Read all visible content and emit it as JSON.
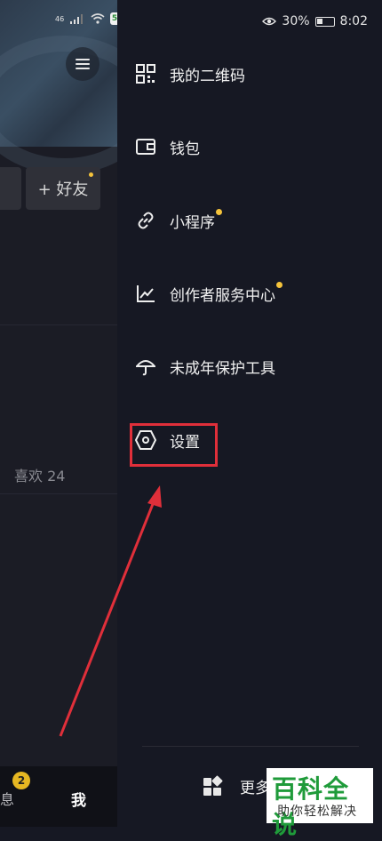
{
  "status_bar": {
    "signal_text": "46",
    "app_badge": "58",
    "battery": "30%",
    "time": "8:02"
  },
  "left_page": {
    "add_friend": "+ 好友",
    "likes": "喜欢 24",
    "tabs": {
      "message": "息",
      "message_badge": "2",
      "me": "我"
    }
  },
  "drawer": {
    "items": [
      {
        "label": "我的二维码",
        "icon": "qr-code-icon",
        "dot": false
      },
      {
        "label": "钱包",
        "icon": "wallet-icon",
        "dot": false
      },
      {
        "label": "小程序",
        "icon": "link-icon",
        "dot": true
      },
      {
        "label": "创作者服务中心",
        "icon": "chart-icon",
        "dot": true
      },
      {
        "label": "未成年保护工具",
        "icon": "umbrella-icon",
        "dot": false
      },
      {
        "label": "设置",
        "icon": "settings-hexagon-icon",
        "dot": false
      }
    ],
    "more": "更多"
  },
  "watermark": {
    "title": "百科全说",
    "subtitle": "助你轻松解决"
  },
  "colors": {
    "highlight": "#e02f3a",
    "accent_dot": "#f5c33b",
    "background": "#161823"
  }
}
